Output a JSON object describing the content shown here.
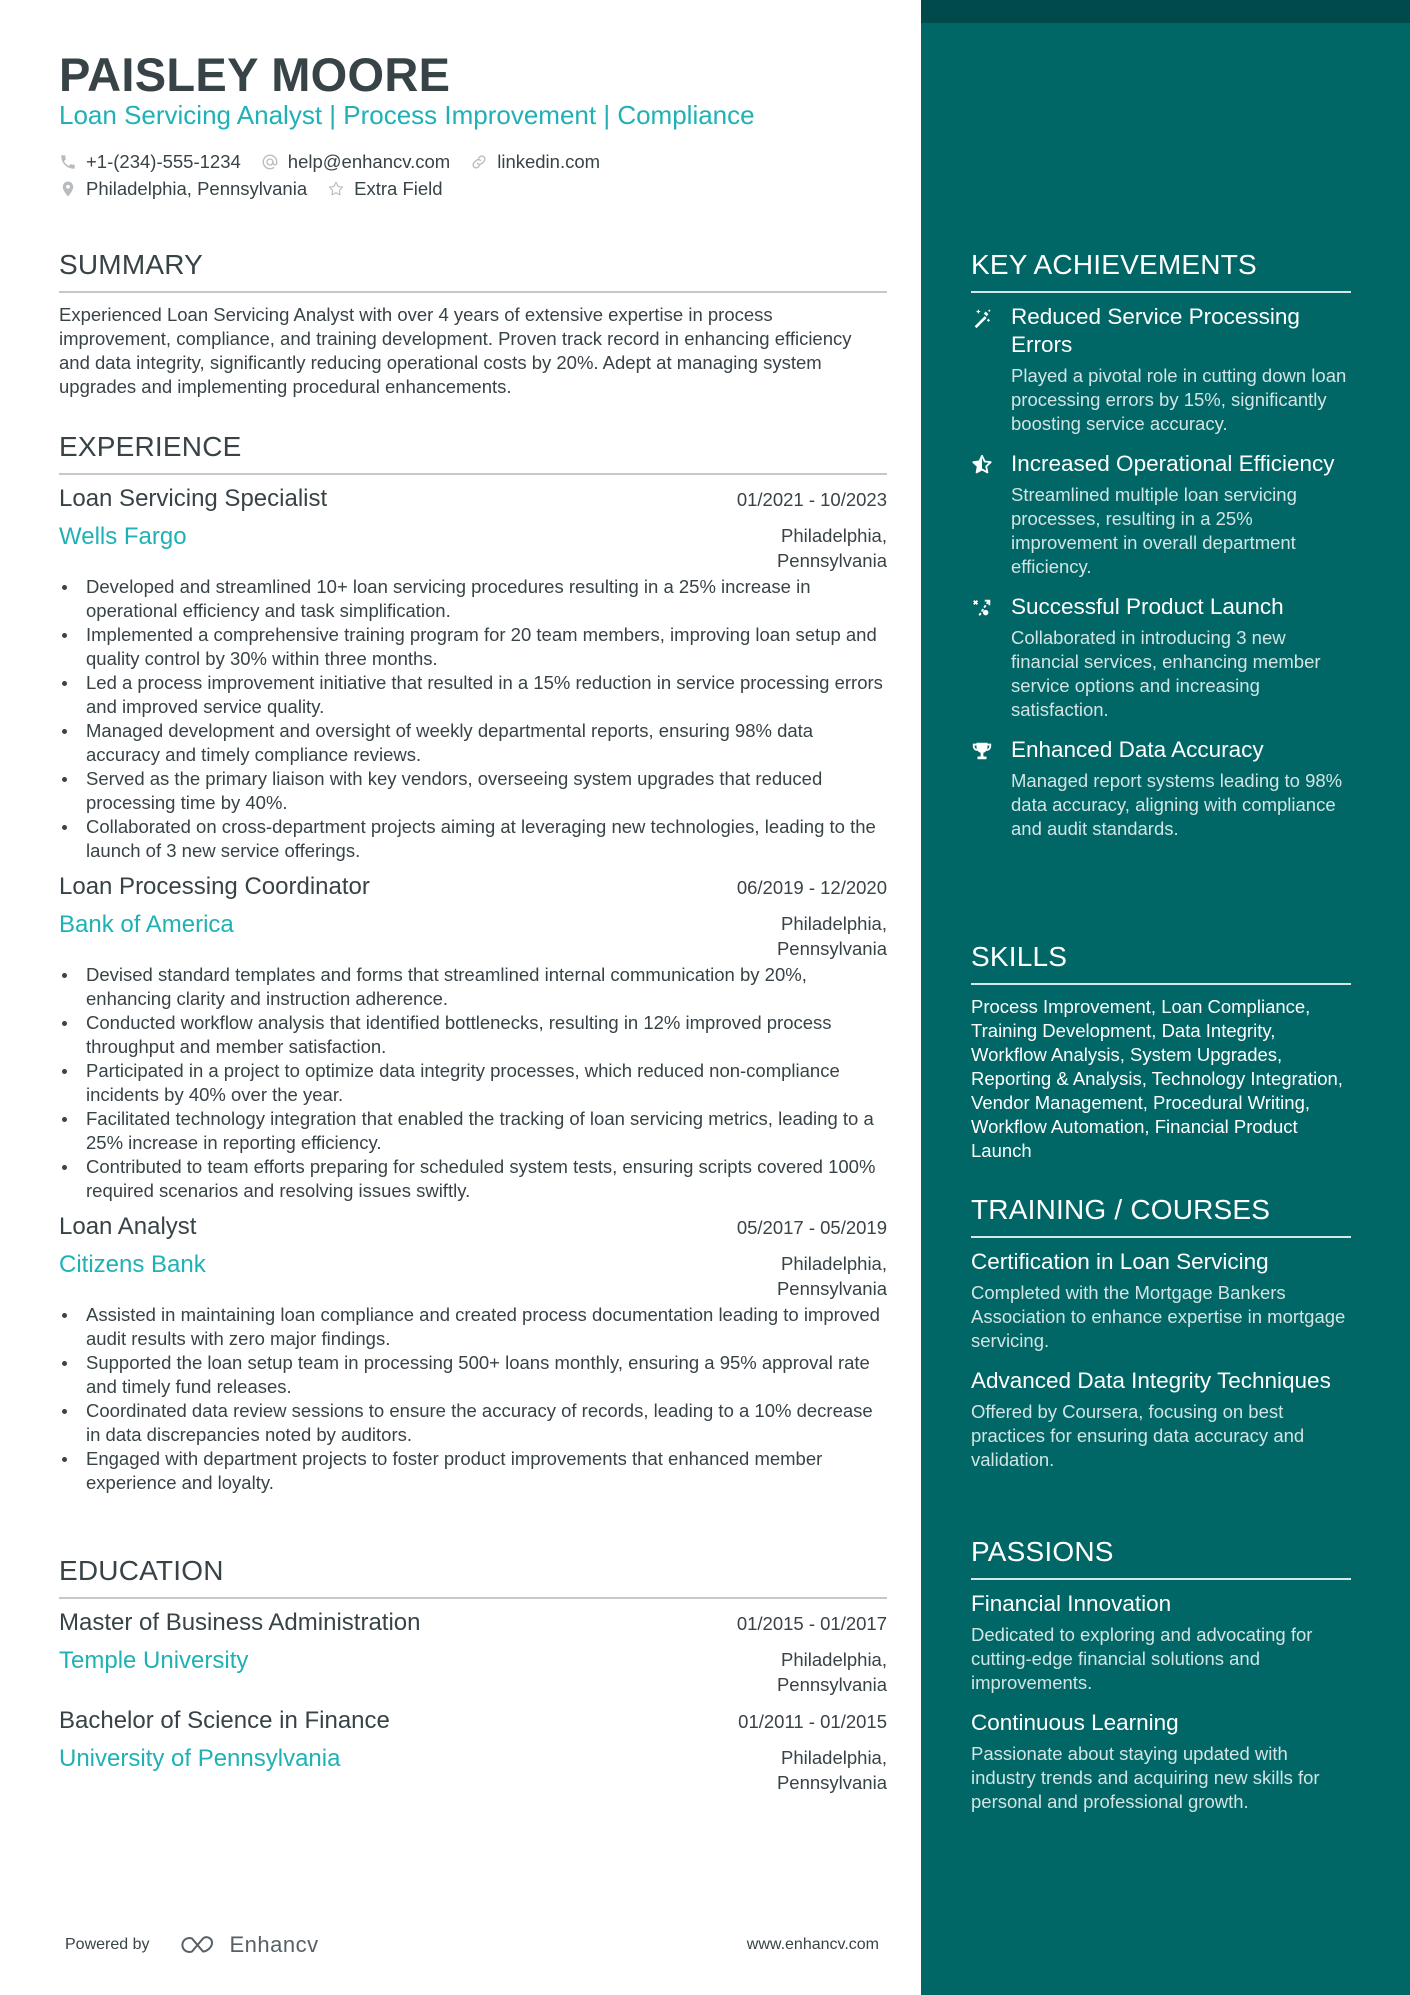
{
  "header": {
    "name": "PAISLEY MOORE",
    "headline": "Loan Servicing Analyst | Process Improvement | Compliance",
    "contacts": {
      "phone": "+1-(234)-555-1234",
      "email": "help@enhancv.com",
      "link": "linkedin.com",
      "location": "Philadelphia, Pennsylvania",
      "extra": "Extra Field"
    }
  },
  "summary": {
    "title": "SUMMARY",
    "text": "Experienced Loan Servicing Analyst with over 4 years of extensive expertise in process improvement, compliance, and training development. Proven track record in enhancing efficiency and data integrity, significantly reducing operational costs by 20%. Adept at managing system upgrades and implementing procedural enhancements."
  },
  "experience": {
    "title": "EXPERIENCE",
    "jobs": [
      {
        "title": "Loan Servicing Specialist",
        "dates": "01/2021 - 10/2023",
        "company": "Wells Fargo",
        "location_line1": "Philadelphia,",
        "location_line2": "Pennsylvania",
        "bullets": [
          "Developed and streamlined 10+ loan servicing procedures resulting in a 25% increase in operational efficiency and task simplification.",
          "Implemented a comprehensive training program for 20 team members, improving loan setup and quality control by 30% within three months.",
          "Led a process improvement initiative that resulted in a 15% reduction in service processing errors and improved service quality.",
          "Managed development and oversight of weekly departmental reports, ensuring 98% data accuracy and timely compliance reviews.",
          "Served as the primary liaison with key vendors, overseeing system upgrades that reduced processing time by 40%.",
          "Collaborated on cross-department projects aiming at leveraging new technologies, leading to the launch of 3 new service offerings."
        ]
      },
      {
        "title": "Loan Processing Coordinator",
        "dates": "06/2019 - 12/2020",
        "company": "Bank of America",
        "location_line1": "Philadelphia,",
        "location_line2": "Pennsylvania",
        "bullets": [
          "Devised standard templates and forms that streamlined internal communication by 20%, enhancing clarity and instruction adherence.",
          "Conducted workflow analysis that identified bottlenecks, resulting in 12% improved process throughput and member satisfaction.",
          "Participated in a project to optimize data integrity processes, which reduced non-compliance incidents by 40% over the year.",
          "Facilitated technology integration that enabled the tracking of loan servicing metrics, leading to a 25% increase in reporting efficiency.",
          "Contributed to team efforts preparing for scheduled system tests, ensuring scripts covered 100% required scenarios and resolving issues swiftly."
        ]
      },
      {
        "title": "Loan Analyst",
        "dates": "05/2017 - 05/2019",
        "company": "Citizens Bank",
        "location_line1": "Philadelphia,",
        "location_line2": "Pennsylvania",
        "bullets": [
          "Assisted in maintaining loan compliance and created process documentation leading to improved audit results with zero major findings.",
          "Supported the loan setup team in processing 500+ loans monthly, ensuring a 95% approval rate and timely fund releases.",
          "Coordinated data review sessions to ensure the accuracy of records, leading to a 10% decrease in data discrepancies noted by auditors.",
          "Engaged with department projects to foster product improvements that enhanced member experience and loyalty."
        ]
      }
    ]
  },
  "education": {
    "title": "EDUCATION",
    "items": [
      {
        "degree": "Master of Business Administration",
        "dates": "01/2015 - 01/2017",
        "school": "Temple University",
        "location_line1": "Philadelphia,",
        "location_line2": "Pennsylvania"
      },
      {
        "degree": "Bachelor of Science in Finance",
        "dates": "01/2011 - 01/2015",
        "school": "University of Pennsylvania",
        "location_line1": "Philadelphia,",
        "location_line2": "Pennsylvania"
      }
    ]
  },
  "achievements": {
    "title": "KEY ACHIEVEMENTS",
    "items": [
      {
        "icon": "magic-wand-icon",
        "title": "Reduced Service Processing Errors",
        "desc": "Played a pivotal role in cutting down loan processing errors by 15%, significantly boosting service accuracy."
      },
      {
        "icon": "star-half-icon",
        "title": "Increased Operational Efficiency",
        "desc": "Streamlined multiple loan servicing processes, resulting in a 25% improvement in overall department efficiency."
      },
      {
        "icon": "route-icon",
        "title": "Successful Product Launch",
        "desc": "Collaborated in introducing 3 new financial services, enhancing member service options and increasing satisfaction."
      },
      {
        "icon": "trophy-icon",
        "title": "Enhanced Data Accuracy",
        "desc": "Managed report systems leading to 98% data accuracy, aligning with compliance and audit standards."
      }
    ]
  },
  "skills": {
    "title": "SKILLS",
    "text": "Process Improvement, Loan Compliance, Training Development, Data Integrity, Workflow Analysis, System Upgrades, Reporting & Analysis, Technology Integration, Vendor Management, Procedural Writing, Workflow Automation, Financial Product Launch"
  },
  "training": {
    "title": "TRAINING / COURSES",
    "items": [
      {
        "title": "Certification in Loan Servicing",
        "desc": "Completed with the Mortgage Bankers Association to enhance expertise in mortgage servicing."
      },
      {
        "title": "Advanced Data Integrity Techniques",
        "desc": "Offered by Coursera, focusing on best practices for ensuring data accuracy and validation."
      }
    ]
  },
  "passions": {
    "title": "PASSIONS",
    "items": [
      {
        "title": "Financial Innovation",
        "desc": "Dedicated to exploring and advocating for cutting-edge financial solutions and improvements."
      },
      {
        "title": "Continuous Learning",
        "desc": "Passionate about staying updated with industry trends and acquiring new skills for personal and professional growth."
      }
    ]
  },
  "footer": {
    "powered_by": "Powered by",
    "brand": "Enhancv",
    "website": "www.enhancv.com"
  },
  "colors": {
    "accent": "#1fb1b5",
    "text": "#384347",
    "sidebar": "#006666",
    "sidebar_band": "#004a4b"
  }
}
